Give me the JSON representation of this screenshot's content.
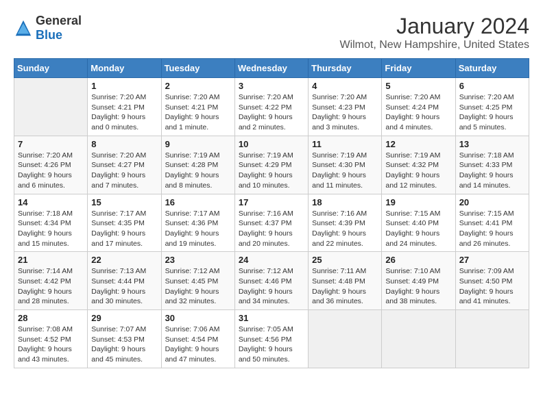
{
  "logo": {
    "general": "General",
    "blue": "Blue"
  },
  "title": "January 2024",
  "subtitle": "Wilmot, New Hampshire, United States",
  "weekdays": [
    "Sunday",
    "Monday",
    "Tuesday",
    "Wednesday",
    "Thursday",
    "Friday",
    "Saturday"
  ],
  "weeks": [
    [
      {
        "day": null
      },
      {
        "day": "1",
        "sunrise": "7:20 AM",
        "sunset": "4:21 PM",
        "daylight": "9 hours and 0 minutes."
      },
      {
        "day": "2",
        "sunrise": "7:20 AM",
        "sunset": "4:21 PM",
        "daylight": "9 hours and 1 minute."
      },
      {
        "day": "3",
        "sunrise": "7:20 AM",
        "sunset": "4:22 PM",
        "daylight": "9 hours and 2 minutes."
      },
      {
        "day": "4",
        "sunrise": "7:20 AM",
        "sunset": "4:23 PM",
        "daylight": "9 hours and 3 minutes."
      },
      {
        "day": "5",
        "sunrise": "7:20 AM",
        "sunset": "4:24 PM",
        "daylight": "9 hours and 4 minutes."
      },
      {
        "day": "6",
        "sunrise": "7:20 AM",
        "sunset": "4:25 PM",
        "daylight": "9 hours and 5 minutes."
      }
    ],
    [
      {
        "day": "7",
        "sunrise": "7:20 AM",
        "sunset": "4:26 PM",
        "daylight": "9 hours and 6 minutes."
      },
      {
        "day": "8",
        "sunrise": "7:20 AM",
        "sunset": "4:27 PM",
        "daylight": "9 hours and 7 minutes."
      },
      {
        "day": "9",
        "sunrise": "7:19 AM",
        "sunset": "4:28 PM",
        "daylight": "9 hours and 8 minutes."
      },
      {
        "day": "10",
        "sunrise": "7:19 AM",
        "sunset": "4:29 PM",
        "daylight": "9 hours and 10 minutes."
      },
      {
        "day": "11",
        "sunrise": "7:19 AM",
        "sunset": "4:30 PM",
        "daylight": "9 hours and 11 minutes."
      },
      {
        "day": "12",
        "sunrise": "7:19 AM",
        "sunset": "4:32 PM",
        "daylight": "9 hours and 12 minutes."
      },
      {
        "day": "13",
        "sunrise": "7:18 AM",
        "sunset": "4:33 PM",
        "daylight": "9 hours and 14 minutes."
      }
    ],
    [
      {
        "day": "14",
        "sunrise": "7:18 AM",
        "sunset": "4:34 PM",
        "daylight": "9 hours and 15 minutes."
      },
      {
        "day": "15",
        "sunrise": "7:17 AM",
        "sunset": "4:35 PM",
        "daylight": "9 hours and 17 minutes."
      },
      {
        "day": "16",
        "sunrise": "7:17 AM",
        "sunset": "4:36 PM",
        "daylight": "9 hours and 19 minutes."
      },
      {
        "day": "17",
        "sunrise": "7:16 AM",
        "sunset": "4:37 PM",
        "daylight": "9 hours and 20 minutes."
      },
      {
        "day": "18",
        "sunrise": "7:16 AM",
        "sunset": "4:39 PM",
        "daylight": "9 hours and 22 minutes."
      },
      {
        "day": "19",
        "sunrise": "7:15 AM",
        "sunset": "4:40 PM",
        "daylight": "9 hours and 24 minutes."
      },
      {
        "day": "20",
        "sunrise": "7:15 AM",
        "sunset": "4:41 PM",
        "daylight": "9 hours and 26 minutes."
      }
    ],
    [
      {
        "day": "21",
        "sunrise": "7:14 AM",
        "sunset": "4:42 PM",
        "daylight": "9 hours and 28 minutes."
      },
      {
        "day": "22",
        "sunrise": "7:13 AM",
        "sunset": "4:44 PM",
        "daylight": "9 hours and 30 minutes."
      },
      {
        "day": "23",
        "sunrise": "7:12 AM",
        "sunset": "4:45 PM",
        "daylight": "9 hours and 32 minutes."
      },
      {
        "day": "24",
        "sunrise": "7:12 AM",
        "sunset": "4:46 PM",
        "daylight": "9 hours and 34 minutes."
      },
      {
        "day": "25",
        "sunrise": "7:11 AM",
        "sunset": "4:48 PM",
        "daylight": "9 hours and 36 minutes."
      },
      {
        "day": "26",
        "sunrise": "7:10 AM",
        "sunset": "4:49 PM",
        "daylight": "9 hours and 38 minutes."
      },
      {
        "day": "27",
        "sunrise": "7:09 AM",
        "sunset": "4:50 PM",
        "daylight": "9 hours and 41 minutes."
      }
    ],
    [
      {
        "day": "28",
        "sunrise": "7:08 AM",
        "sunset": "4:52 PM",
        "daylight": "9 hours and 43 minutes."
      },
      {
        "day": "29",
        "sunrise": "7:07 AM",
        "sunset": "4:53 PM",
        "daylight": "9 hours and 45 minutes."
      },
      {
        "day": "30",
        "sunrise": "7:06 AM",
        "sunset": "4:54 PM",
        "daylight": "9 hours and 47 minutes."
      },
      {
        "day": "31",
        "sunrise": "7:05 AM",
        "sunset": "4:56 PM",
        "daylight": "9 hours and 50 minutes."
      },
      {
        "day": null
      },
      {
        "day": null
      },
      {
        "day": null
      }
    ]
  ],
  "labels": {
    "sunrise": "Sunrise:",
    "sunset": "Sunset:",
    "daylight": "Daylight:"
  }
}
